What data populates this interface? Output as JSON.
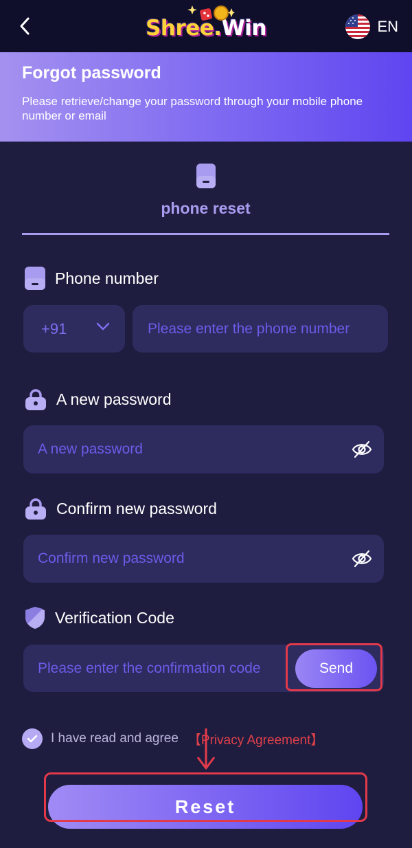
{
  "header": {
    "logo_part1": "Shree",
    "logo_part2": ".",
    "logo_part3": "Win",
    "language": "EN",
    "icons": {
      "back": "chevron-left-icon",
      "flag": "us-flag-icon"
    }
  },
  "hero": {
    "title": "Forgot password",
    "subtitle": "Please retrieve/change your password through your mobile phone number or email"
  },
  "tab": {
    "label": "phone reset",
    "icon": "phone-icon"
  },
  "form": {
    "phone_label": "Phone number",
    "country_code": "+91",
    "phone_placeholder": "Please enter the phone number",
    "new_password_label": "A new password",
    "new_password_placeholder": "A new password",
    "confirm_password_label": "Confirm new password",
    "confirm_password_placeholder": "Confirm new password",
    "verification_label": "Verification Code",
    "verification_placeholder": "Please enter the confirmation code",
    "send_label": "Send"
  },
  "agreement": {
    "text": "I have read and agree",
    "link": "【Privacy Agreement】",
    "checked": true
  },
  "reset_label": "Reset",
  "colors": {
    "background": "#1f1d3f",
    "topbar": "#0f0f2c",
    "input": "#2e2b5f",
    "accent": "#6b53f2",
    "placeholder": "#6b5ce8",
    "highlight": "#e23a4a"
  }
}
